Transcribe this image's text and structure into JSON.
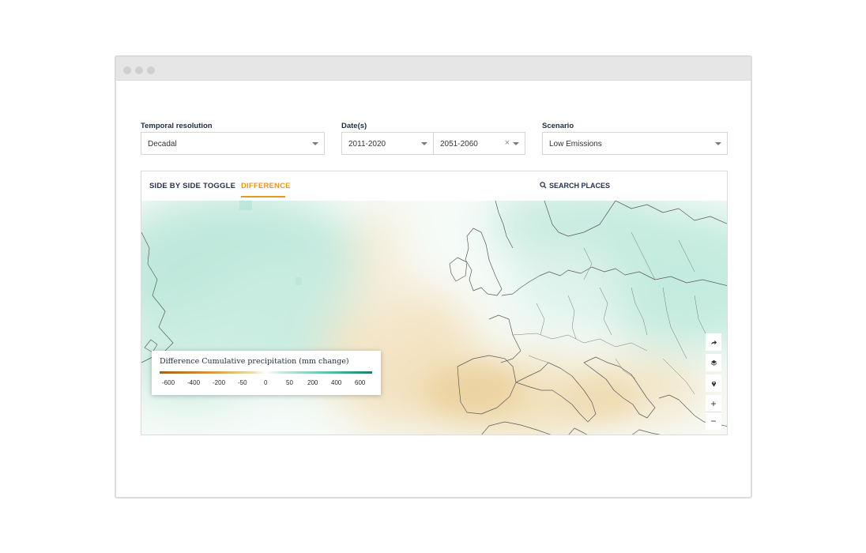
{
  "filters": {
    "temporal_resolution": {
      "label": "Temporal resolution",
      "value": "Decadal"
    },
    "dates": {
      "label": "Date(s)",
      "start": "2011-2020",
      "end": "2051-2060",
      "clear_symbol": "×"
    },
    "scenario": {
      "label": "Scenario",
      "value": "Low Emissions"
    }
  },
  "tabs": [
    {
      "label": "SIDE BY SIDE",
      "active": false
    },
    {
      "label": "TOGGLE",
      "active": false
    },
    {
      "label": "DIFFERENCE",
      "active": true
    }
  ],
  "search": {
    "label": "SEARCH PLACES",
    "icon": "search-icon"
  },
  "map_controls": {
    "share": "share-icon",
    "layers": "layers-icon",
    "locate": "location-pin-icon",
    "zoom_in": "+",
    "zoom_out": "−"
  },
  "legend": {
    "title": "Difference Cumulative precipitation (mm change)",
    "ticks": [
      "-600",
      "-400",
      "-200",
      "-50",
      "0",
      "50",
      "200",
      "400",
      "600"
    ]
  },
  "colors": {
    "accent": "#e39b1c",
    "heading": "#24344c",
    "dry": "#a4611a",
    "wet": "#1a7f6c"
  }
}
